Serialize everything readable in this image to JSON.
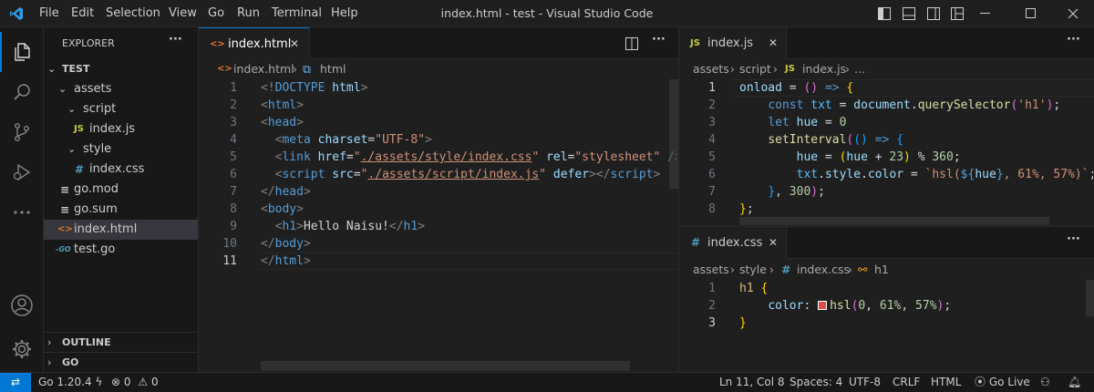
{
  "window": {
    "title": "index.html - test - Visual Studio Code",
    "menu": [
      "File",
      "Edit",
      "Selection",
      "View",
      "Go",
      "Run",
      "Terminal",
      "Help"
    ]
  },
  "colors": {
    "accent": "#0078d4",
    "keyword": "#569cd6",
    "string": "#ce9178",
    "attr": "#9cdcfe",
    "func": "#dcdcaa",
    "number": "#b5cea8",
    "bracket": "#ffd700",
    "html_icon": "#e37933",
    "js_icon": "#cbcb41",
    "css_icon": "#519aba",
    "go_icon": "#519aba"
  },
  "activity": [
    "explorer-icon",
    "search-icon",
    "source-control-icon",
    "run-debug-icon",
    "more-icon",
    "account-icon",
    "manage-gear-icon"
  ],
  "sidebar": {
    "title": "EXPLORER",
    "more": "···",
    "root": "TEST",
    "items": [
      {
        "label": "assets",
        "icon": "folder",
        "depth": 1
      },
      {
        "label": "script",
        "icon": "folder",
        "depth": 2
      },
      {
        "label": "index.js",
        "icon": "JS",
        "depth": 3
      },
      {
        "label": "style",
        "icon": "folder",
        "depth": 2
      },
      {
        "label": "index.css",
        "icon": "#",
        "depth": 3
      },
      {
        "label": "go.mod",
        "icon": "≡",
        "depth": 1
      },
      {
        "label": "go.sum",
        "icon": "≡",
        "depth": 1
      },
      {
        "label": "index.html",
        "icon": "<>",
        "depth": 1
      },
      {
        "label": "test.go",
        "icon": "-GO",
        "depth": 1
      }
    ],
    "outline": "OUTLINE",
    "go_section": "GO"
  },
  "editor_left": {
    "tab": "index.html",
    "close": "✕",
    "breadcrumb": [
      "index.html",
      "html"
    ],
    "lines": [
      "1",
      "2",
      "3",
      "4",
      "5",
      "6",
      "7",
      "8",
      "9",
      "10",
      "11"
    ]
  },
  "editor_js": {
    "tab": "index.js",
    "close": "✕",
    "breadcrumb": [
      "assets",
      "script",
      "index.js",
      "..."
    ],
    "lines": [
      "1",
      "2",
      "3",
      "4",
      "5",
      "6",
      "7",
      "8"
    ]
  },
  "editor_css": {
    "tab": "index.css",
    "close": "✕",
    "breadcrumb": [
      "assets",
      "style",
      "index.css",
      "h1"
    ],
    "lines": [
      "1",
      "2",
      "3"
    ],
    "swatch": "#d94d4d"
  },
  "statusbar": {
    "remote": "⇄",
    "go_version": "Go 1.20.4",
    "errors": "0",
    "warnings": "0",
    "position": "Ln 11, Col 8",
    "spaces": "Spaces: 4",
    "encoding": "UTF-8",
    "eol": "CRLF",
    "language": "HTML",
    "golive": "Go Live"
  }
}
